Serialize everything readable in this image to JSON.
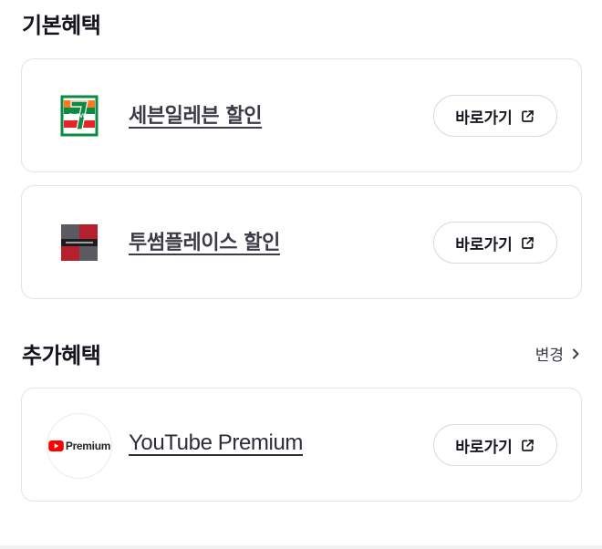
{
  "basic_benefits": {
    "title": "기본혜택",
    "items": [
      {
        "name": "세븐일레븐 할인",
        "button_label": "바로가기",
        "logo": "seven-eleven-logo"
      },
      {
        "name": "투썸플레이스 할인",
        "button_label": "바로가기",
        "logo": "twosome-place-logo"
      }
    ]
  },
  "extra_benefits": {
    "title": "추가혜택",
    "change_label": "변경",
    "items": [
      {
        "name": "YouTube Premium",
        "button_label": "바로가기",
        "logo": "youtube-premium-logo",
        "logo_text": "Premium"
      }
    ]
  },
  "colors": {
    "seven_green": "#0b8a43",
    "seven_orange": "#f47b20",
    "seven_red": "#e5252a",
    "twosome_red": "#b5202e",
    "twosome_gray": "#5a5a60",
    "youtube_red": "#ff0000"
  },
  "icons": {
    "external_link": "external-link-icon",
    "chevron_right": "chevron-right-icon"
  }
}
